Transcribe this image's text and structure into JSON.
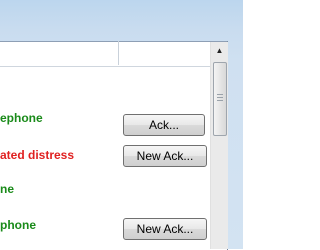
{
  "alarms": [
    {
      "text": "ephone",
      "color": "#1a8b1a",
      "button": "Ack..."
    },
    {
      "text": "ated distress",
      "color": "#e02020",
      "button": "New Ack..."
    },
    {
      "text": "ne",
      "color": "#1a8b1a",
      "button": ""
    },
    {
      "text": "phone",
      "color": "#1a8b1a",
      "button": "New Ack..."
    }
  ],
  "scrollbar": {
    "up_arrow_icon": "triangle-up"
  }
}
